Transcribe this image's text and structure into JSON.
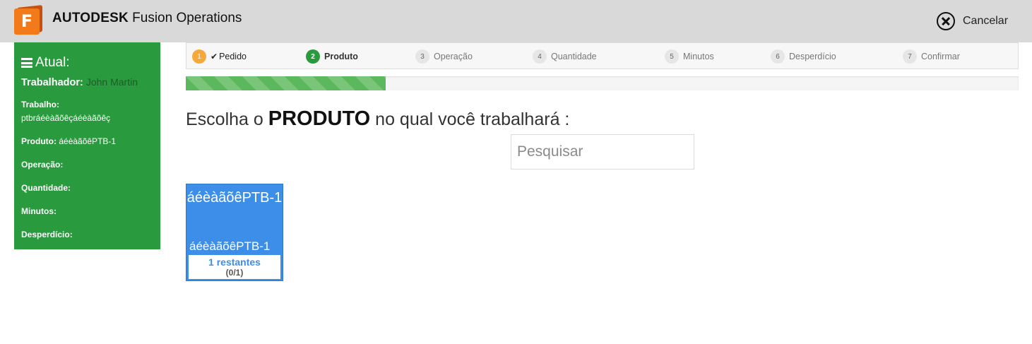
{
  "header": {
    "logo_letter": "F",
    "brand_bold": "AUTODESK",
    "brand_rest": " Fusion Operations",
    "cancel_label": "Cancelar"
  },
  "sidebar": {
    "title": "Atual:",
    "worker_label": "Trabalhador:",
    "worker_value": "John Martin",
    "rows": [
      {
        "label": "Trabalho:",
        "value": "ptbráéèàãõêçáéèàãõêç"
      },
      {
        "label": "Produto:",
        "value": "áéèàãõêPTB-1"
      },
      {
        "label": "Operação:",
        "value": ""
      },
      {
        "label": "Quantidade:",
        "value": ""
      },
      {
        "label": "Minutos:",
        "value": ""
      },
      {
        "label": "Desperdício:",
        "value": ""
      }
    ]
  },
  "steps": [
    {
      "num": "1",
      "label": "Pedido",
      "state": "done"
    },
    {
      "num": "2",
      "label": "Produto",
      "state": "active"
    },
    {
      "num": "3",
      "label": "Operação",
      "state": "pending"
    },
    {
      "num": "4",
      "label": "Quantidade",
      "state": "pending"
    },
    {
      "num": "5",
      "label": "Minutos",
      "state": "pending"
    },
    {
      "num": "6",
      "label": "Desperdício",
      "state": "pending"
    },
    {
      "num": "7",
      "label": "Confirmar",
      "state": "pending"
    }
  ],
  "progress": {
    "fraction": 0.24,
    "color": "#5cb85c"
  },
  "main": {
    "heading_pre": "Escolha o ",
    "heading_bold": "PRODUTO",
    "heading_post": " no qual você trabalhará :",
    "search_placeholder": "Pesquisar"
  },
  "products": [
    {
      "title": "áéèàãõêPTB-1",
      "name": "áéèàãõêPTB-1",
      "remaining": "1 restantes",
      "count": "(0/1)"
    }
  ],
  "colors": {
    "sidebar": "#2a9a3e",
    "tile": "#3d8ee8",
    "step_done": "#f6a93b",
    "step_active": "#2a9a3e"
  }
}
